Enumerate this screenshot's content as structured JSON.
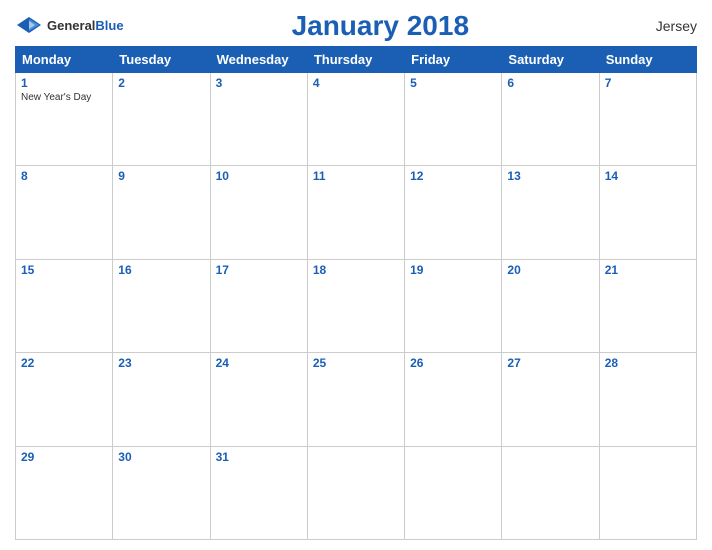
{
  "header": {
    "logo_general": "General",
    "logo_blue": "Blue",
    "title": "January 2018",
    "region": "Jersey"
  },
  "days_of_week": [
    "Monday",
    "Tuesday",
    "Wednesday",
    "Thursday",
    "Friday",
    "Saturday",
    "Sunday"
  ],
  "weeks": [
    [
      {
        "day": "1",
        "holiday": "New Year's Day"
      },
      {
        "day": "2",
        "holiday": ""
      },
      {
        "day": "3",
        "holiday": ""
      },
      {
        "day": "4",
        "holiday": ""
      },
      {
        "day": "5",
        "holiday": ""
      },
      {
        "day": "6",
        "holiday": ""
      },
      {
        "day": "7",
        "holiday": ""
      }
    ],
    [
      {
        "day": "8",
        "holiday": ""
      },
      {
        "day": "9",
        "holiday": ""
      },
      {
        "day": "10",
        "holiday": ""
      },
      {
        "day": "11",
        "holiday": ""
      },
      {
        "day": "12",
        "holiday": ""
      },
      {
        "day": "13",
        "holiday": ""
      },
      {
        "day": "14",
        "holiday": ""
      }
    ],
    [
      {
        "day": "15",
        "holiday": ""
      },
      {
        "day": "16",
        "holiday": ""
      },
      {
        "day": "17",
        "holiday": ""
      },
      {
        "day": "18",
        "holiday": ""
      },
      {
        "day": "19",
        "holiday": ""
      },
      {
        "day": "20",
        "holiday": ""
      },
      {
        "day": "21",
        "holiday": ""
      }
    ],
    [
      {
        "day": "22",
        "holiday": ""
      },
      {
        "day": "23",
        "holiday": ""
      },
      {
        "day": "24",
        "holiday": ""
      },
      {
        "day": "25",
        "holiday": ""
      },
      {
        "day": "26",
        "holiday": ""
      },
      {
        "day": "27",
        "holiday": ""
      },
      {
        "day": "28",
        "holiday": ""
      }
    ],
    [
      {
        "day": "29",
        "holiday": ""
      },
      {
        "day": "30",
        "holiday": ""
      },
      {
        "day": "31",
        "holiday": ""
      },
      {
        "day": "",
        "holiday": ""
      },
      {
        "day": "",
        "holiday": ""
      },
      {
        "day": "",
        "holiday": ""
      },
      {
        "day": "",
        "holiday": ""
      }
    ]
  ]
}
